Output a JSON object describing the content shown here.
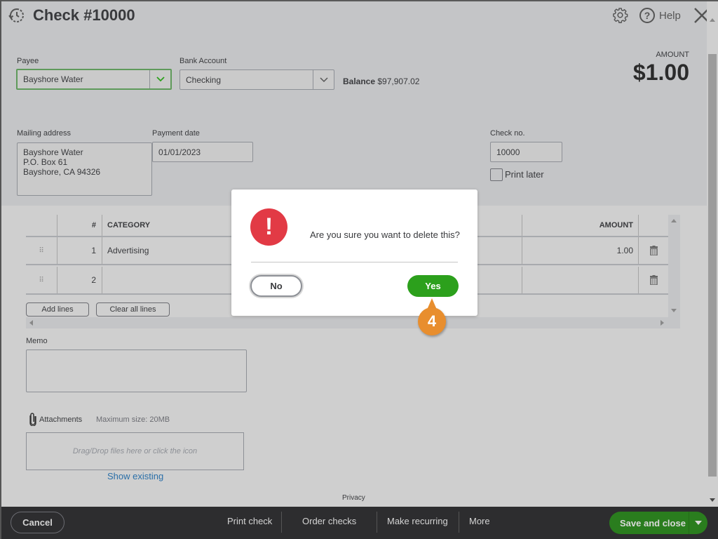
{
  "header": {
    "title": "Check #10000",
    "icons": {
      "recent": "history-clock-icon",
      "settings": "gear-icon",
      "help": "help-circle-icon",
      "close": "close-x-icon"
    },
    "help_label": "Help"
  },
  "form": {
    "payee": {
      "label": "Payee",
      "value": "Bayshore Water"
    },
    "bank_account": {
      "label": "Bank Account",
      "value": "Checking"
    },
    "balance": {
      "label": "Balance",
      "value": "$97,907.02"
    },
    "amount": {
      "label": "AMOUNT",
      "value": "$1.00"
    },
    "mailing_address": {
      "label": "Mailing address",
      "lines": [
        "Bayshore Water",
        "P.O. Box 61",
        "Bayshore, CA  94326"
      ]
    },
    "payment_date": {
      "label": "Payment date",
      "value": "01/01/2023"
    },
    "check_no": {
      "label": "Check no.",
      "value": "10000"
    },
    "print_later": {
      "label": "Print later",
      "checked": false
    }
  },
  "table": {
    "headers": {
      "drag": "",
      "num": "#",
      "category": "CATEGORY",
      "amount": "AMOUNT"
    },
    "rows": [
      {
        "num": "1",
        "category": "Advertising",
        "amount": "1.00"
      },
      {
        "num": "2",
        "category": "",
        "amount": ""
      }
    ],
    "add_lines": "Add lines",
    "clear_lines": "Clear all lines"
  },
  "memo": {
    "label": "Memo",
    "value": ""
  },
  "attachments": {
    "label": "Attachments",
    "max_size": "Maximum size: 20MB",
    "dropzone": "Drag/Drop files here or click the icon",
    "show_existing": "Show existing"
  },
  "privacy": "Privacy",
  "footer": {
    "cancel": "Cancel",
    "print_check": "Print check",
    "order_checks": "Order checks",
    "make_recurring": "Make recurring",
    "more": "More",
    "save_and_close": "Save and close"
  },
  "dialog": {
    "message": "Are you sure you want to delete this?",
    "icon": "exclamation-alert-icon",
    "no": "No",
    "yes": "Yes"
  },
  "callout": {
    "step": "4"
  },
  "colors": {
    "accent_green": "#2ca01c",
    "save_green": "#2a7d1e",
    "alert_red": "#e23a45",
    "callout_orange": "#e88e2e",
    "link_blue": "#2a6fa8"
  }
}
